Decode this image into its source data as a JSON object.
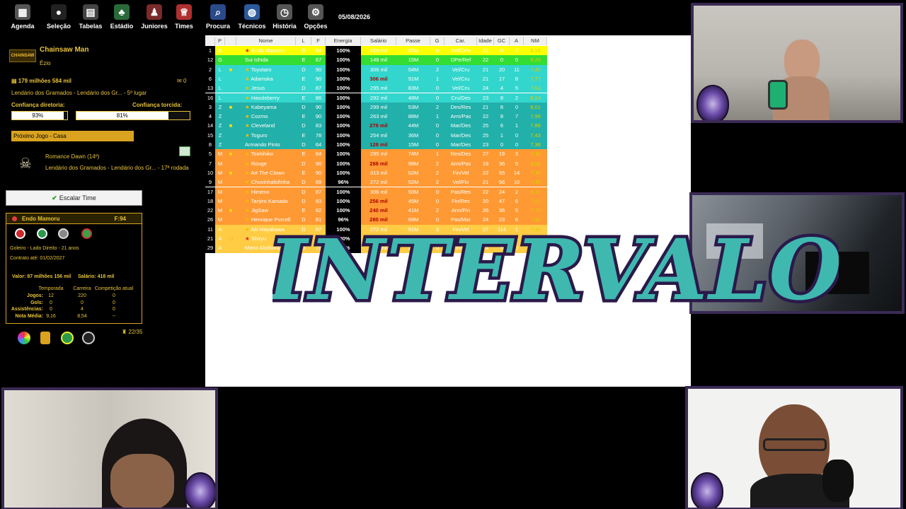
{
  "toolbar": {
    "items": [
      {
        "label": "Agenda",
        "icon": "calendar-icon"
      },
      {
        "label": "Seleção",
        "icon": "flag-icon"
      },
      {
        "label": "Tabelas",
        "icon": "table-icon"
      },
      {
        "label": "Estádio",
        "icon": "stadium-icon"
      },
      {
        "label": "Juniores",
        "icon": "junior-player-icon"
      },
      {
        "label": "Times",
        "icon": "shirt-icon"
      },
      {
        "label": "Procura",
        "icon": "search-icon"
      },
      {
        "label": "Técnicos",
        "icon": "coach-icon"
      },
      {
        "label": "História",
        "icon": "history-icon"
      },
      {
        "label": "Opções",
        "icon": "options-icon"
      }
    ],
    "date": "05/08/2026"
  },
  "club": {
    "logo_text": "CHAINSAW",
    "name": "Chainsaw Man",
    "coach": "Ézio",
    "money": "179 milhões 584 mil",
    "messages": "0",
    "league": "Lendário dos Gramados - Lendário dos Gr... - 5º lugar",
    "confidence_board_label": "Confiança diretoria:",
    "confidence_board_value": "93%",
    "confidence_board_fraction": 0.93,
    "confidence_fans_label": "Confiança torcida:",
    "confidence_fans_value": "81%",
    "confidence_fans_fraction": 0.81
  },
  "next_game": {
    "label": "Próximo Jogo - Casa",
    "opponent": "Romance Dawn (14º)",
    "league": "Lendário dos Gramados - Lendário dos Gr... - 17ª rodada"
  },
  "escalar_button": "Escalar Time",
  "player_card": {
    "name": "Endo Mamoru",
    "force": "F:94",
    "position_info": "Goleiro - Lado Direito - 21 anos",
    "contract": "Contrato até: 01/02/2027",
    "value": "Valor: 87 milhões 156 mil",
    "salary": "Salário: 418 mil",
    "columns": [
      "Temporada",
      "Carreira",
      "Competição atual"
    ],
    "stats": [
      {
        "label": "Jogos:",
        "values": [
          "12",
          "220",
          "0"
        ]
      },
      {
        "label": "Gols:",
        "values": [
          "0",
          "0",
          "0"
        ]
      },
      {
        "label": "Assistências:",
        "values": [
          "0",
          "4",
          "0"
        ]
      },
      {
        "label": "Nota Média:",
        "values": [
          "9,16",
          "8,54",
          "--"
        ]
      }
    ],
    "trophies": "22/35"
  },
  "table": {
    "headers": [
      "P",
      "Nome",
      "L",
      "F",
      "Energia",
      "Salário",
      "Passe",
      "G",
      "Car.",
      "Idade",
      "GC",
      "A",
      "NM"
    ],
    "rows": [
      {
        "num": "1",
        "p": "G",
        "star": "red",
        "card": "",
        "name": "Endo Mamoru",
        "l": "D",
        "f": "94",
        "en": "100%",
        "sal": "418 mil",
        "salred": false,
        "passe": "87M",
        "g": "0",
        "car": "Ref/DPe",
        "idade": "21",
        "gc": "0",
        "a": "0",
        "nm": "9,16",
        "bg": "#ffff00"
      },
      {
        "num": "12",
        "p": "G",
        "star": "",
        "card": "",
        "name": "Sui Ishida",
        "l": "E",
        "f": "67",
        "en": "100%",
        "sal": "148 mil",
        "salred": false,
        "passe": "15M",
        "g": "0",
        "car": "DPe/Ref",
        "idade": "22",
        "gc": "0",
        "a": "0",
        "nm": "9,20",
        "bg": "#33dd33"
      },
      {
        "num": "2",
        "p": "L",
        "star": "gold",
        "card": "yellow",
        "name": "Toyotaro",
        "l": "D",
        "f": "90",
        "en": "100%",
        "sal": "306 mil",
        "salred": false,
        "passe": "54M",
        "g": "2",
        "car": "Vel/Cru",
        "idade": "21",
        "gc": "20",
        "a": "11",
        "nm": "7,42",
        "bg": "#33d6cc"
      },
      {
        "num": "6",
        "p": "L",
        "star": "gold",
        "card": "",
        "name": "Adamska",
        "l": "E",
        "f": "90",
        "en": "100%",
        "sal": "306 mil",
        "salred": true,
        "passe": "91M",
        "g": "1",
        "car": "Vel/Cru",
        "idade": "21",
        "gc": "17",
        "a": "8",
        "nm": "7,77",
        "bg": "#33d6cc"
      },
      {
        "num": "13",
        "p": "L",
        "star": "gold",
        "card": "",
        "name": "Jesus",
        "l": "D",
        "f": "87",
        "en": "100%",
        "sal": "295 mil",
        "salred": false,
        "passe": "83M",
        "g": "0",
        "car": "Vel/Cru",
        "idade": "24",
        "gc": "4",
        "a": "5",
        "nm": "7,64",
        "bg": "#33d6cc"
      },
      {
        "num": "16",
        "p": "L",
        "star": "gold",
        "card": "",
        "name": "Hassleberry",
        "l": "E",
        "f": "86",
        "en": "100%",
        "sal": "292 mil",
        "salred": false,
        "passe": "48M",
        "g": "0",
        "car": "Cru/Des",
        "idade": "23",
        "gc": "8",
        "a": "2",
        "nm": "8,24",
        "bg": "#33d6cc"
      },
      {
        "num": "3",
        "p": "Z",
        "star": "gold",
        "card": "yellow",
        "name": "Kabeyama",
        "l": "D",
        "f": "90",
        "en": "100%",
        "sal": "299 mil",
        "salred": false,
        "passe": "53M",
        "g": "2",
        "car": "Des/Res",
        "idade": "21",
        "gc": "8",
        "a": "0",
        "nm": "8,01",
        "bg": "#22b0aa"
      },
      {
        "num": "4",
        "p": "Z",
        "star": "gold",
        "card": "",
        "name": "Cozmo",
        "l": "E",
        "f": "90",
        "en": "100%",
        "sal": "263 mil",
        "salred": false,
        "passe": "88M",
        "g": "1",
        "car": "Arm/Pas",
        "idade": "22",
        "gc": "8",
        "a": "7",
        "nm": "7,95",
        "bg": "#22b0aa"
      },
      {
        "num": "14",
        "p": "Z",
        "star": "gold",
        "card": "yellow",
        "name": "Cleveland",
        "l": "D",
        "f": "83",
        "en": "100%",
        "sal": "278 mil",
        "salred": true,
        "passe": "44M",
        "g": "0",
        "car": "Mar/Des",
        "idade": "25",
        "gc": "6",
        "a": "1",
        "nm": "7,86",
        "bg": "#22b0aa"
      },
      {
        "num": "15",
        "p": "Z",
        "star": "gold",
        "card": "",
        "name": "Toguro",
        "l": "E",
        "f": "78",
        "en": "100%",
        "sal": "254 mil",
        "salred": false,
        "passe": "36M",
        "g": "0",
        "car": "Mar/Des",
        "idade": "25",
        "gc": "1",
        "a": "0",
        "nm": "7,43",
        "bg": "#22b0aa"
      },
      {
        "num": "8",
        "p": "Z",
        "star": "",
        "card": "",
        "name": "Armando Pinto",
        "l": "D",
        "f": "64",
        "en": "100%",
        "sal": "128 mil",
        "salred": true,
        "passe": "15M",
        "g": "0",
        "car": "Mar/Des",
        "idade": "23",
        "gc": "0",
        "a": "0",
        "nm": "7,38",
        "bg": "#22b0aa"
      },
      {
        "num": "5",
        "p": "M",
        "star": "gold",
        "card": "yellow",
        "name": "Toshihiko",
        "l": "E",
        "f": "84",
        "en": "100%",
        "sal": "295 mil",
        "salred": false,
        "passe": "74M",
        "g": "1",
        "car": "Res/Des",
        "idade": "27",
        "gc": "19",
        "a": "3",
        "nm": "7,46",
        "bg": "#ff9933"
      },
      {
        "num": "7",
        "p": "M",
        "star": "gold",
        "card": "",
        "name": "Rouge",
        "l": "D",
        "f": "90",
        "en": "100%",
        "sal": "288 mil",
        "salred": true,
        "passe": "98M",
        "g": "2",
        "car": "Arm/Pas",
        "idade": "19",
        "gc": "36",
        "a": "5",
        "nm": "8,06",
        "bg": "#ff9933"
      },
      {
        "num": "10",
        "p": "M",
        "star": "gold",
        "card": "yellow",
        "name": "Art The Clown",
        "l": "E",
        "f": "90",
        "en": "100%",
        "sal": "313 mil",
        "salred": false,
        "passe": "52M",
        "g": "2",
        "car": "Fin/Vel",
        "idade": "22",
        "gc": "55",
        "a": "14",
        "nm": "7,49",
        "bg": "#ff9933"
      },
      {
        "num": "9",
        "p": "M",
        "star": "gold",
        "card": "",
        "name": "Chuvinhafofinha",
        "l": "D",
        "f": "89",
        "en": "96%",
        "sal": "272 mil",
        "salred": false,
        "passe": "52M",
        "g": "2",
        "car": "Vel/Fin",
        "idade": "21",
        "gc": "56",
        "a": "10",
        "nm": "7,48",
        "bg": "#ff9933"
      },
      {
        "num": "17",
        "p": "M",
        "star": "gold",
        "card": "",
        "name": "Himeno",
        "l": "D",
        "f": "87",
        "en": "100%",
        "sal": "306 mil",
        "salred": false,
        "passe": "50M",
        "g": "0",
        "car": "Pas/Res",
        "idade": "22",
        "gc": "24",
        "a": "2",
        "nm": "8,37",
        "bg": "#ff9933"
      },
      {
        "num": "18",
        "p": "M",
        "star": "gold",
        "card": "",
        "name": "Tanjiro Kamado",
        "l": "D",
        "f": "83",
        "en": "100%",
        "sal": "256 mil",
        "salred": true,
        "passe": "45M",
        "g": "0",
        "car": "Fin/Res",
        "idade": "20",
        "gc": "47",
        "a": "6",
        "nm": "7,22",
        "bg": "#ff9933"
      },
      {
        "num": "22",
        "p": "M",
        "star": "gold",
        "card": "yellow",
        "name": "JigSaw",
        "l": "E",
        "f": "82",
        "en": "100%",
        "sal": "240 mil",
        "salred": true,
        "passe": "41M",
        "g": "2",
        "car": "Arm/Fin",
        "idade": "26",
        "gc": "36",
        "a": "5",
        "nm": "7,73",
        "bg": "#ff9933"
      },
      {
        "num": "26",
        "p": "M",
        "star": "gold",
        "card": "",
        "name": "Henrique Purcell",
        "l": "D",
        "f": "81",
        "en": "96%",
        "sal": "280 mil",
        "salred": true,
        "passe": "69M",
        "g": "0",
        "car": "Pas/Mar",
        "idade": "24",
        "gc": "23",
        "a": "6",
        "nm": "7,93",
        "bg": "#ff9933"
      },
      {
        "num": "11",
        "p": "A",
        "star": "gold",
        "card": "",
        "name": "Aki Hayakawa",
        "l": "D",
        "f": "87",
        "en": "100%",
        "sal": "272 mil",
        "salred": false,
        "passe": "91M",
        "g": "3",
        "car": "Fin/Vel",
        "idade": "27",
        "gc": "114",
        "a": "1",
        "nm": "7,42",
        "bg": "#ffcc44"
      },
      {
        "num": "21",
        "p": "A",
        "star": "red",
        "card": "outline",
        "name": "Shiryu",
        "l": "D",
        "f": "84",
        "en": "100%",
        "sal": "283 mil",
        "salred": true,
        "passe": "28M",
        "g": "6",
        "car": "Vel/Fin",
        "idade": "19",
        "gc": "83",
        "a": "3",
        "nm": "8,51",
        "bg": "#ffcc44"
      },
      {
        "num": "29",
        "p": "A",
        "star": "",
        "card": "",
        "name": "Mano Abóbora",
        "l": "D",
        "f": "79",
        "en": "100%",
        "sal": "254 mil",
        "salred": false,
        "passe": "28M",
        "g": "0",
        "car": "Fin/Vel",
        "idade": "24",
        "gc": "6",
        "a": "0",
        "nm": "7,10",
        "bg": "#ffcc44"
      }
    ]
  },
  "overlay_text": "INTERVALO",
  "colors": {
    "gold": "#e8c33a",
    "overlay_fill": "#3fb8b0",
    "overlay_stroke": "#2a1a4a",
    "cam_border": "#3b2a55"
  }
}
